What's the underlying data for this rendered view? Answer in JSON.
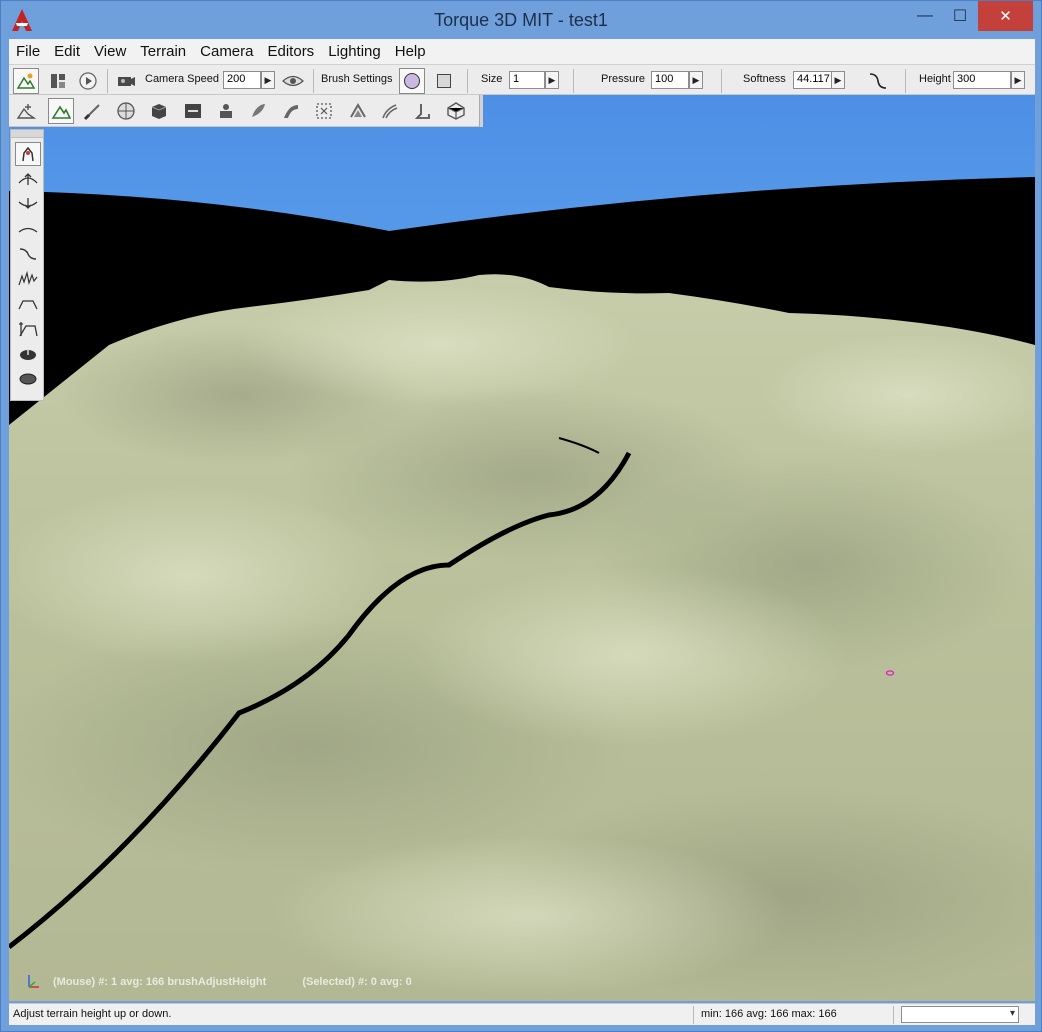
{
  "window": {
    "title": "Torque 3D MIT - test1",
    "minimize_glyph": "—",
    "maximize_glyph": "☐",
    "close_glyph": "✕"
  },
  "menu": [
    "File",
    "Edit",
    "View",
    "Terrain",
    "Camera",
    "Editors",
    "Lighting",
    "Help"
  ],
  "toolbar": {
    "camera_speed_label": "Camera Speed",
    "camera_speed_value": "200",
    "brush_settings_label": "Brush Settings",
    "size_label": "Size",
    "size_value": "1",
    "pressure_label": "Pressure",
    "pressure_value": "100",
    "softness_label": "Softness",
    "softness_value": "44.117",
    "height_label": "Height",
    "height_value": "300",
    "arrow_glyph": "▶"
  },
  "icons": {
    "toolbar1": [
      "world-editor-icon",
      "gui-editor-icon",
      "play-icon",
      "camera-icon",
      "visibility-eye-icon",
      "brush-circle-icon",
      "brush-square-icon",
      "softness-curve-icon"
    ],
    "toolbar2": [
      "object-editor-icon",
      "terrain-editor-icon",
      "terrain-painter-icon",
      "material-editor-icon",
      "sketch-tool-icon",
      "datablock-editor-icon",
      "particle-editor-icon",
      "forest-editor-icon",
      "road-editor-icon",
      "decal-editor-icon",
      "mesh-road-editor-icon",
      "river-editor-icon",
      "shape-editor-icon",
      "navmesh-editor-icon"
    ],
    "palette": [
      "grab-terrain-icon",
      "raise-height-icon",
      "lower-height-icon",
      "smooth-icon",
      "smooth-slope-icon",
      "add-noise-icon",
      "flatten-icon",
      "set-height-icon",
      "clear-terrain-icon",
      "restore-terrain-icon"
    ]
  },
  "viewport": {
    "overlay_mouse": "(Mouse) #: 1  avg: 166 brushAdjustHeight",
    "overlay_selected": "(Selected) #: 0  avg: 0"
  },
  "status": {
    "message": "Adjust terrain height up or down.",
    "stats": "min: 166  avg: 166  max: 166",
    "dropdown_value": ""
  },
  "colors": {
    "title_bar": "#6fa0dc",
    "close_button": "#c4403b",
    "sky": "#5f9fe8",
    "terrain": "#c9cfad",
    "void": "#000000"
  }
}
